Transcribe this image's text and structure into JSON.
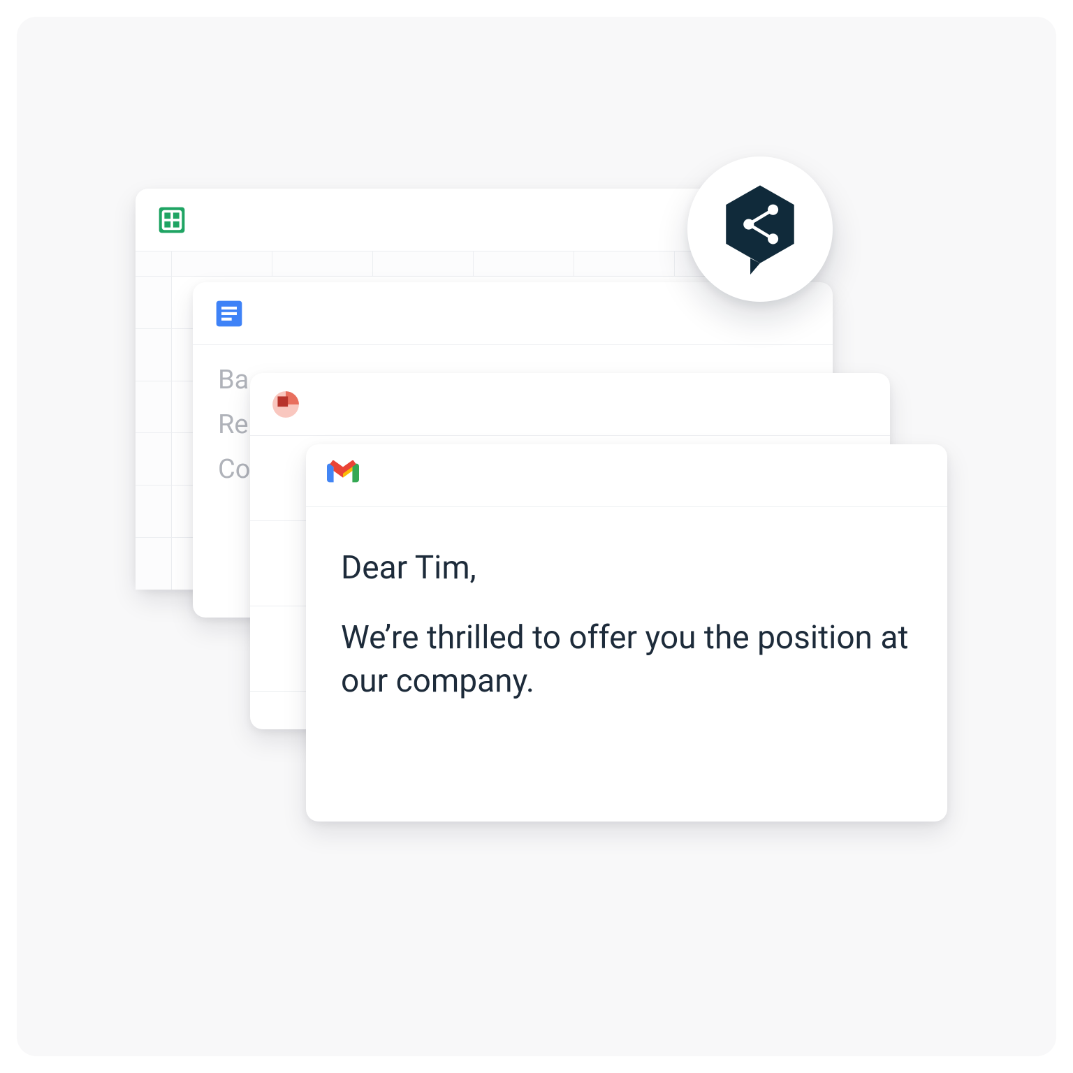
{
  "cards": {
    "sheets": {
      "app": "google-sheets"
    },
    "docs": {
      "app": "google-docs",
      "lines": {
        "l0": "Ba",
        "l1": "Re",
        "l2": "Co"
      }
    },
    "slides": {
      "app": "google-slides"
    },
    "gmail": {
      "app": "gmail",
      "greeting": "Dear Tim,",
      "body": "We’re thrilled to offer you the position at our company."
    }
  },
  "badge": {
    "name": "share-hex-icon"
  }
}
